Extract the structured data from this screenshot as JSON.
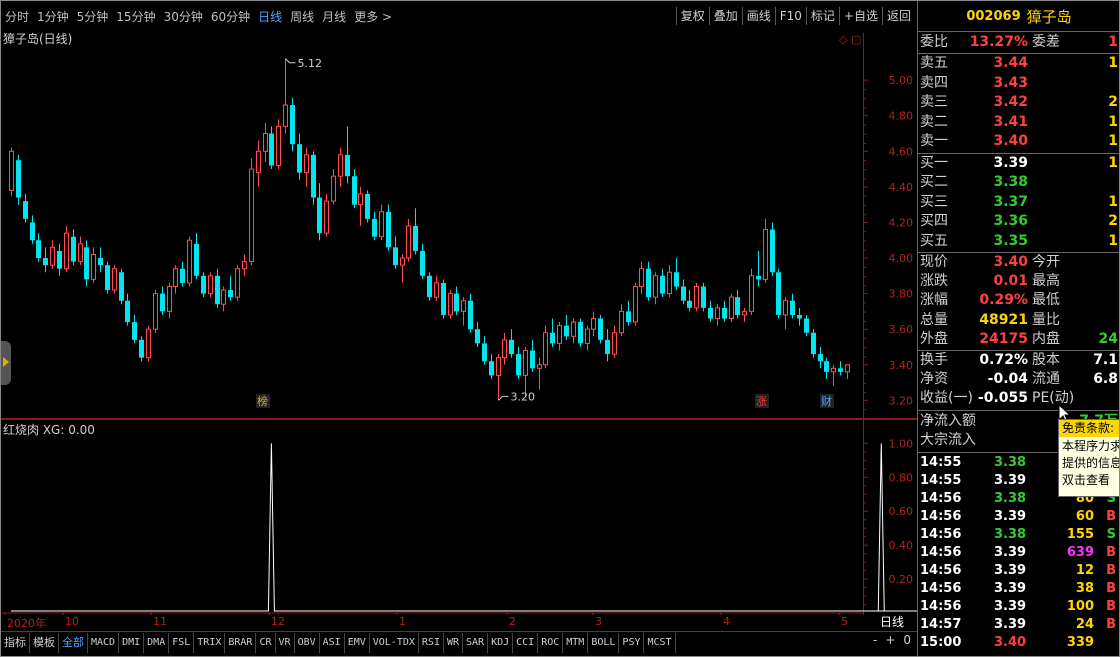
{
  "toolbar": {
    "periods": [
      "分时",
      "1分钟",
      "5分钟",
      "15分钟",
      "30分钟",
      "60分钟",
      "日线",
      "周线",
      "月线",
      "更多 >"
    ],
    "active_period": "日线",
    "tools": [
      "复权",
      "叠加",
      "画线",
      "F10",
      "标记",
      "+自选",
      "返回"
    ]
  },
  "main_chart": {
    "title": "獐子岛(日线)",
    "corner_icons": "◇ ▢",
    "annotations": {
      "high": "5.12",
      "low": "3.20"
    },
    "badges": [
      {
        "text": "榜",
        "color": "#d9a441"
      },
      {
        "text": "涨",
        "color": "#ff3333"
      },
      {
        "text": "财",
        "color": "#4fa3ff"
      }
    ]
  },
  "chart_data": [
    {
      "type": "candlestick",
      "title": "獐子岛(日线)",
      "y_ticks": [
        "5.00",
        "4.80",
        "4.60",
        "4.40",
        "4.20",
        "4.00",
        "3.80",
        "3.60",
        "3.40",
        "3.20"
      ],
      "ylim": [
        3.14,
        5.22
      ],
      "x_ticks": [
        "2020年",
        "10",
        "11",
        "12",
        "1",
        "2",
        "3",
        "4",
        "5"
      ],
      "high_label": 5.12,
      "low_label": 3.2,
      "up_color": "#ff4d4d",
      "down_color": "#00e5ee",
      "ohlc": [
        [
          4.38,
          4.62,
          4.35,
          4.6
        ],
        [
          4.55,
          4.58,
          4.3,
          4.34
        ],
        [
          4.32,
          4.36,
          4.2,
          4.22
        ],
        [
          4.2,
          4.24,
          4.08,
          4.1
        ],
        [
          4.1,
          4.14,
          3.98,
          4.0
        ],
        [
          4.0,
          4.06,
          3.92,
          3.96
        ],
        [
          3.96,
          4.1,
          3.94,
          4.06
        ],
        [
          4.04,
          4.08,
          3.9,
          3.94
        ],
        [
          3.94,
          4.18,
          3.92,
          4.14
        ],
        [
          4.12,
          4.16,
          3.96,
          3.98
        ],
        [
          3.98,
          4.12,
          3.96,
          4.08
        ],
        [
          4.06,
          4.1,
          3.84,
          3.88
        ],
        [
          3.88,
          4.06,
          3.86,
          4.02
        ],
        [
          4.0,
          4.06,
          3.92,
          3.96
        ],
        [
          3.96,
          3.98,
          3.8,
          3.82
        ],
        [
          3.82,
          3.96,
          3.8,
          3.94
        ],
        [
          3.92,
          3.94,
          3.74,
          3.76
        ],
        [
          3.76,
          3.8,
          3.62,
          3.64
        ],
        [
          3.64,
          3.68,
          3.52,
          3.54
        ],
        [
          3.54,
          3.56,
          3.42,
          3.44
        ],
        [
          3.44,
          3.62,
          3.42,
          3.6
        ],
        [
          3.6,
          3.82,
          3.58,
          3.8
        ],
        [
          3.8,
          3.84,
          3.68,
          3.7
        ],
        [
          3.7,
          3.86,
          3.66,
          3.84
        ],
        [
          3.84,
          3.96,
          3.8,
          3.94
        ],
        [
          3.94,
          3.98,
          3.84,
          3.86
        ],
        [
          3.86,
          4.12,
          3.84,
          4.1
        ],
        [
          4.08,
          4.14,
          3.88,
          3.9
        ],
        [
          3.9,
          3.92,
          3.78,
          3.8
        ],
        [
          3.8,
          3.92,
          3.78,
          3.9
        ],
        [
          3.9,
          3.94,
          3.72,
          3.74
        ],
        [
          3.74,
          3.84,
          3.7,
          3.82
        ],
        [
          3.82,
          3.9,
          3.76,
          3.78
        ],
        [
          3.78,
          3.96,
          3.76,
          3.94
        ],
        [
          3.94,
          4.02,
          3.9,
          3.98
        ],
        [
          3.98,
          4.56,
          3.96,
          4.5
        ],
        [
          4.48,
          4.66,
          4.4,
          4.6
        ],
        [
          4.6,
          4.76,
          4.54,
          4.7
        ],
        [
          4.7,
          4.74,
          4.5,
          4.52
        ],
        [
          4.52,
          4.78,
          4.5,
          4.74
        ],
        [
          4.74,
          5.12,
          4.7,
          4.86
        ],
        [
          4.86,
          4.9,
          4.6,
          4.64
        ],
        [
          4.64,
          4.7,
          4.44,
          4.48
        ],
        [
          4.48,
          4.62,
          4.4,
          4.58
        ],
        [
          4.58,
          4.6,
          4.3,
          4.34
        ],
        [
          4.34,
          4.42,
          4.1,
          4.14
        ],
        [
          4.14,
          4.36,
          4.12,
          4.32
        ],
        [
          4.32,
          4.5,
          4.3,
          4.46
        ],
        [
          4.46,
          4.62,
          4.4,
          4.58
        ],
        [
          4.58,
          4.74,
          4.42,
          4.46
        ],
        [
          4.46,
          4.5,
          4.28,
          4.3
        ],
        [
          4.3,
          4.4,
          4.18,
          4.36
        ],
        [
          4.36,
          4.38,
          4.2,
          4.22
        ],
        [
          4.22,
          4.26,
          4.1,
          4.12
        ],
        [
          4.12,
          4.3,
          4.1,
          4.26
        ],
        [
          4.26,
          4.3,
          4.04,
          4.06
        ],
        [
          4.06,
          4.12,
          3.94,
          3.96
        ],
        [
          3.96,
          4.02,
          3.86,
          4.0
        ],
        [
          4.0,
          4.22,
          3.98,
          4.18
        ],
        [
          4.18,
          4.28,
          4.02,
          4.04
        ],
        [
          4.04,
          4.08,
          3.88,
          3.9
        ],
        [
          3.9,
          3.92,
          3.76,
          3.78
        ],
        [
          3.78,
          3.9,
          3.76,
          3.86
        ],
        [
          3.86,
          3.88,
          3.66,
          3.68
        ],
        [
          3.68,
          3.82,
          3.66,
          3.8
        ],
        [
          3.8,
          3.84,
          3.68,
          3.7
        ],
        [
          3.7,
          3.78,
          3.62,
          3.76
        ],
        [
          3.76,
          3.8,
          3.58,
          3.6
        ],
        [
          3.6,
          3.64,
          3.5,
          3.52
        ],
        [
          3.52,
          3.56,
          3.4,
          3.42
        ],
        [
          3.42,
          3.46,
          3.32,
          3.34
        ],
        [
          3.34,
          3.46,
          3.2,
          3.44
        ],
        [
          3.44,
          3.58,
          3.4,
          3.54
        ],
        [
          3.54,
          3.6,
          3.44,
          3.46
        ],
        [
          3.46,
          3.5,
          3.32,
          3.34
        ],
        [
          3.34,
          3.5,
          3.22,
          3.48
        ],
        [
          3.48,
          3.54,
          3.36,
          3.38
        ],
        [
          3.38,
          3.44,
          3.26,
          3.4
        ],
        [
          3.4,
          3.62,
          3.38,
          3.58
        ],
        [
          3.58,
          3.66,
          3.5,
          3.52
        ],
        [
          3.52,
          3.64,
          3.48,
          3.62
        ],
        [
          3.62,
          3.68,
          3.54,
          3.56
        ],
        [
          3.56,
          3.66,
          3.52,
          3.64
        ],
        [
          3.64,
          3.66,
          3.5,
          3.52
        ],
        [
          3.52,
          3.62,
          3.48,
          3.6
        ],
        [
          3.6,
          3.7,
          3.56,
          3.66
        ],
        [
          3.66,
          3.68,
          3.52,
          3.54
        ],
        [
          3.54,
          3.6,
          3.42,
          3.46
        ],
        [
          3.46,
          3.62,
          3.44,
          3.58
        ],
        [
          3.58,
          3.74,
          3.56,
          3.7
        ],
        [
          3.7,
          3.76,
          3.62,
          3.64
        ],
        [
          3.64,
          3.86,
          3.62,
          3.84
        ],
        [
          3.84,
          3.98,
          3.8,
          3.94
        ],
        [
          3.94,
          3.98,
          3.76,
          3.78
        ],
        [
          3.78,
          3.92,
          3.74,
          3.9
        ],
        [
          3.9,
          3.94,
          3.78,
          3.8
        ],
        [
          3.8,
          3.96,
          3.78,
          3.92
        ],
        [
          3.92,
          4.0,
          3.82,
          3.84
        ],
        [
          3.84,
          3.88,
          3.74,
          3.76
        ],
        [
          3.76,
          3.82,
          3.7,
          3.72
        ],
        [
          3.72,
          3.86,
          3.7,
          3.84
        ],
        [
          3.84,
          3.86,
          3.7,
          3.72
        ],
        [
          3.72,
          3.76,
          3.64,
          3.66
        ],
        [
          3.66,
          3.74,
          3.62,
          3.72
        ],
        [
          3.72,
          3.76,
          3.64,
          3.66
        ],
        [
          3.66,
          3.8,
          3.64,
          3.78
        ],
        [
          3.78,
          3.82,
          3.66,
          3.68
        ],
        [
          3.68,
          3.72,
          3.64,
          3.7
        ],
        [
          3.7,
          3.94,
          3.68,
          3.9
        ],
        [
          3.9,
          4.04,
          3.84,
          3.88
        ],
        [
          3.88,
          4.22,
          3.86,
          4.16
        ],
        [
          4.16,
          4.2,
          3.9,
          3.92
        ],
        [
          3.92,
          3.94,
          3.66,
          3.68
        ],
        [
          3.68,
          3.78,
          3.6,
          3.76
        ],
        [
          3.76,
          3.8,
          3.66,
          3.68
        ],
        [
          3.68,
          3.72,
          3.62,
          3.66
        ],
        [
          3.66,
          3.68,
          3.56,
          3.58
        ],
        [
          3.58,
          3.6,
          3.44,
          3.46
        ],
        [
          3.46,
          3.5,
          3.38,
          3.42
        ],
        [
          3.42,
          3.44,
          3.32,
          3.36
        ],
        [
          3.36,
          3.4,
          3.28,
          3.38
        ],
        [
          3.38,
          3.42,
          3.34,
          3.36
        ],
        [
          3.36,
          3.4,
          3.32,
          3.4
        ]
      ]
    },
    {
      "type": "line",
      "title": "红烧肉 XG: 0.00",
      "series": [
        {
          "name": "XG",
          "color": "#ffffff"
        }
      ],
      "y_ticks": [
        "1.00",
        "0.80",
        "0.60",
        "0.40",
        "0.20"
      ],
      "ylim": [
        0,
        1.12
      ],
      "signal_bars": [
        38,
        127,
        134
      ],
      "bar_count": 123
    }
  ],
  "indicator": {
    "title": "红烧肉 XG: 0.00"
  },
  "bottom_tabs": {
    "items": [
      "指标",
      "模板",
      "全部",
      "MACD",
      "DMI",
      "DMA",
      "FSL",
      "TRIX",
      "BRAR",
      "CR",
      "VR",
      "OBV",
      "ASI",
      "EMV",
      "VOL-TDX",
      "RSI",
      "WR",
      "SAR",
      "KDJ",
      "CCI",
      "ROC",
      "MTM",
      "BOLL",
      "PSY",
      "MCST"
    ],
    "active": "全部",
    "period_label": "日线",
    "zoom": [
      "-",
      "+",
      "0"
    ]
  },
  "quote_panel": {
    "code": "002069",
    "name": "獐子岛",
    "weibi": {
      "label": "委比",
      "value": "13.27%",
      "label2": "委差",
      "value2": "1"
    },
    "sells": [
      {
        "label": "卖五",
        "price": "3.44",
        "vol": "1"
      },
      {
        "label": "卖四",
        "price": "3.43",
        "vol": ""
      },
      {
        "label": "卖三",
        "price": "3.42",
        "vol": "2"
      },
      {
        "label": "卖二",
        "price": "3.41",
        "vol": "1"
      },
      {
        "label": "卖一",
        "price": "3.40",
        "vol": "1"
      }
    ],
    "buys": [
      {
        "label": "买一",
        "price": "3.39",
        "vol": "1"
      },
      {
        "label": "买二",
        "price": "3.38",
        "vol": ""
      },
      {
        "label": "买三",
        "price": "3.37",
        "vol": "1"
      },
      {
        "label": "买四",
        "price": "3.36",
        "vol": "2"
      },
      {
        "label": "买五",
        "price": "3.35",
        "vol": "1"
      }
    ],
    "stats": [
      {
        "l1": "现价",
        "v1": "3.40",
        "c1": "up",
        "l2": "今开",
        "v2": ""
      },
      {
        "l1": "涨跌",
        "v1": "0.01",
        "c1": "up",
        "l2": "最高",
        "v2": ""
      },
      {
        "l1": "涨幅",
        "v1": "0.29%",
        "c1": "up",
        "l2": "最低",
        "v2": ""
      },
      {
        "l1": "总量",
        "v1": "48921",
        "c1": "ye",
        "l2": "量比",
        "v2": ""
      },
      {
        "l1": "外盘",
        "v1": "24175",
        "c1": "up",
        "l2": "内盘",
        "v2": "24",
        "c2": "dn"
      }
    ],
    "stats2": [
      {
        "l1": "换手",
        "v1": "0.72%",
        "c1": "wh",
        "l2": "股本",
        "v2": "7.1",
        "c2": "wh"
      },
      {
        "l1": "净资",
        "v1": "-0.04",
        "c1": "wh",
        "l2": "流通",
        "v2": "6.8",
        "c2": "wh"
      },
      {
        "l1": "收益(一)",
        "v1": "-0.055",
        "c1": "wh",
        "l2": "PE(动)",
        "v2": ""
      }
    ],
    "flow": [
      {
        "label": "净流入额",
        "value": "7.7万"
      },
      {
        "label": "大宗流入",
        "value": ""
      }
    ],
    "ticks": [
      {
        "time": "14:55",
        "price": "3.38",
        "pc": "dn",
        "vol": "",
        "vc": "ye",
        "flag": ""
      },
      {
        "time": "14:55",
        "price": "3.39",
        "pc": "wh",
        "vol": "",
        "vc": "ye",
        "flag": ""
      },
      {
        "time": "14:56",
        "price": "3.38",
        "pc": "dn",
        "vol": "80",
        "vc": "ye",
        "flag": "S"
      },
      {
        "time": "14:56",
        "price": "3.39",
        "pc": "wh",
        "vol": "60",
        "vc": "ye",
        "flag": "B"
      },
      {
        "time": "14:56",
        "price": "3.38",
        "pc": "dn",
        "vol": "155",
        "vc": "ye",
        "flag": "S"
      },
      {
        "time": "14:56",
        "price": "3.39",
        "pc": "wh",
        "vol": "639",
        "vc": "mg",
        "flag": "B"
      },
      {
        "time": "14:56",
        "price": "3.39",
        "pc": "wh",
        "vol": "12",
        "vc": "ye",
        "flag": "B"
      },
      {
        "time": "14:56",
        "price": "3.39",
        "pc": "wh",
        "vol": "38",
        "vc": "ye",
        "flag": "B"
      },
      {
        "time": "14:56",
        "price": "3.39",
        "pc": "wh",
        "vol": "100",
        "vc": "ye",
        "flag": "B"
      },
      {
        "time": "14:57",
        "price": "3.39",
        "pc": "wh",
        "vol": "24",
        "vc": "ye",
        "flag": "B"
      },
      {
        "time": "15:00",
        "price": "3.40",
        "pc": "up",
        "vol": "339",
        "vc": "ye",
        "flag": ""
      }
    ],
    "tooltip": {
      "title": "免责条款:",
      "lines": [
        "本程序力求",
        "提供的信息",
        "双击查看"
      ]
    }
  }
}
